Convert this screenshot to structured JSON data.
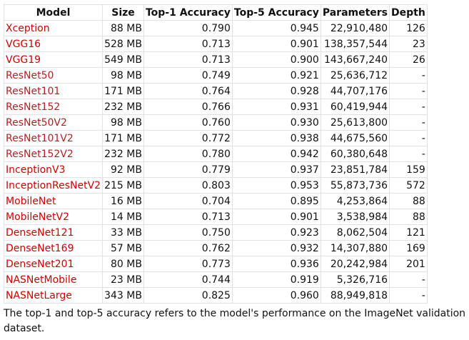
{
  "table": {
    "headers": [
      "Model",
      "Size",
      "Top-1 Accuracy",
      "Top-5 Accuracy",
      "Parameters",
      "Depth"
    ],
    "rows": [
      {
        "model": "Xception",
        "size": "88 MB",
        "top1": "0.790",
        "top5": "0.945",
        "params": "22,910,480",
        "depth": "126",
        "link_style": "a"
      },
      {
        "model": "VGG16",
        "size": "528 MB",
        "top1": "0.713",
        "top5": "0.901",
        "params": "138,357,544",
        "depth": "23",
        "link_style": "a"
      },
      {
        "model": "VGG19",
        "size": "549 MB",
        "top1": "0.713",
        "top5": "0.900",
        "params": "143,667,240",
        "depth": "26",
        "link_style": "a"
      },
      {
        "model": "ResNet50",
        "size": "98 MB",
        "top1": "0.749",
        "top5": "0.921",
        "params": "25,636,712",
        "depth": "-",
        "link_style": "b"
      },
      {
        "model": "ResNet101",
        "size": "171 MB",
        "top1": "0.764",
        "top5": "0.928",
        "params": "44,707,176",
        "depth": "-",
        "link_style": "b"
      },
      {
        "model": "ResNet152",
        "size": "232 MB",
        "top1": "0.766",
        "top5": "0.931",
        "params": "60,419,944",
        "depth": "-",
        "link_style": "b"
      },
      {
        "model": "ResNet50V2",
        "size": "98 MB",
        "top1": "0.760",
        "top5": "0.930",
        "params": "25,613,800",
        "depth": "-",
        "link_style": "b"
      },
      {
        "model": "ResNet101V2",
        "size": "171 MB",
        "top1": "0.772",
        "top5": "0.938",
        "params": "44,675,560",
        "depth": "-",
        "link_style": "b"
      },
      {
        "model": "ResNet152V2",
        "size": "232 MB",
        "top1": "0.780",
        "top5": "0.942",
        "params": "60,380,648",
        "depth": "-",
        "link_style": "b"
      },
      {
        "model": "InceptionV3",
        "size": "92 MB",
        "top1": "0.779",
        "top5": "0.937",
        "params": "23,851,784",
        "depth": "159",
        "link_style": "a"
      },
      {
        "model": "InceptionResNetV2",
        "size": "215 MB",
        "top1": "0.803",
        "top5": "0.953",
        "params": "55,873,736",
        "depth": "572",
        "link_style": "a"
      },
      {
        "model": "MobileNet",
        "size": "16 MB",
        "top1": "0.704",
        "top5": "0.895",
        "params": "4,253,864",
        "depth": "88",
        "link_style": "a"
      },
      {
        "model": "MobileNetV2",
        "size": "14 MB",
        "top1": "0.713",
        "top5": "0.901",
        "params": "3,538,984",
        "depth": "88",
        "link_style": "a"
      },
      {
        "model": "DenseNet121",
        "size": "33 MB",
        "top1": "0.750",
        "top5": "0.923",
        "params": "8,062,504",
        "depth": "121",
        "link_style": "a"
      },
      {
        "model": "DenseNet169",
        "size": "57 MB",
        "top1": "0.762",
        "top5": "0.932",
        "params": "14,307,880",
        "depth": "169",
        "link_style": "a"
      },
      {
        "model": "DenseNet201",
        "size": "80 MB",
        "top1": "0.773",
        "top5": "0.936",
        "params": "20,242,984",
        "depth": "201",
        "link_style": "a"
      },
      {
        "model": "NASNetMobile",
        "size": "23 MB",
        "top1": "0.744",
        "top5": "0.919",
        "params": "5,326,716",
        "depth": "-",
        "link_style": "a"
      },
      {
        "model": "NASNetLarge",
        "size": "343 MB",
        "top1": "0.825",
        "top5": "0.960",
        "params": "88,949,818",
        "depth": "-",
        "link_style": "a"
      }
    ]
  },
  "caption": "The top-1 and top-5 accuracy refers to the model's performance on the ImageNet validation dataset.",
  "colors": {
    "link_primary": "#d00000",
    "link_secondary": "#b22222",
    "border": "#e2e2e2",
    "text": "#111111"
  }
}
